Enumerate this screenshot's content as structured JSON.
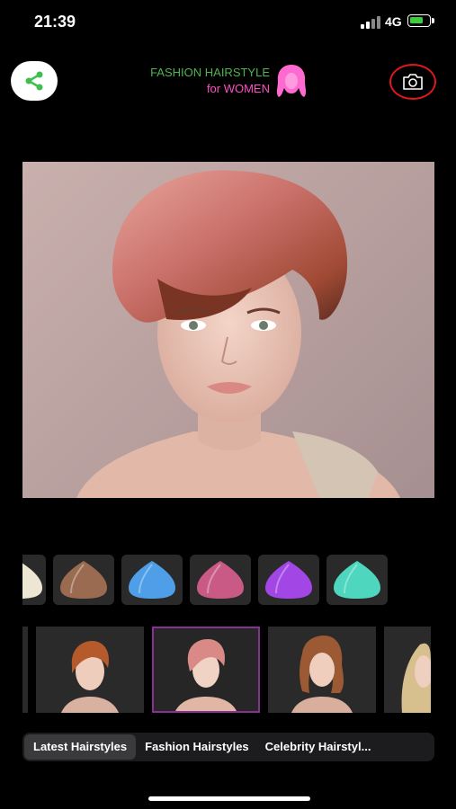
{
  "status_bar": {
    "time": "21:39",
    "network": "4G",
    "battery_level": 0.75
  },
  "header": {
    "title_line1": "FASHION HAIRSTYLE",
    "title_line2": "for WOMEN",
    "share_icon": "share-icon",
    "camera_icon": "camera-icon"
  },
  "colors": {
    "title_green": "#4fb34f",
    "title_pink": "#ff4fc5",
    "camera_ring": "#e01818",
    "selected_border": "#8a2f93"
  },
  "hair_colors": [
    {
      "name": "platinum-blonde",
      "color": "#ece6d2"
    },
    {
      "name": "light-brown",
      "color": "#9a6b50"
    },
    {
      "name": "blue",
      "color": "#4e9fe8"
    },
    {
      "name": "pink",
      "color": "#c95a86"
    },
    {
      "name": "purple",
      "color": "#a246e6"
    },
    {
      "name": "mint",
      "color": "#4fd6bf"
    }
  ],
  "hairstyles": [
    {
      "name": "partial",
      "selected": false
    },
    {
      "name": "short-auburn",
      "selected": false
    },
    {
      "name": "pink-pixie",
      "selected": true
    },
    {
      "name": "brown-bob",
      "selected": false
    },
    {
      "name": "blonde-waves",
      "selected": false
    }
  ],
  "tabs": [
    {
      "label": "Latest Hairstyles",
      "active": true
    },
    {
      "label": "Fashion Hairstyles",
      "active": false
    },
    {
      "label": "Celebrity Hairstyl...",
      "active": false
    }
  ]
}
